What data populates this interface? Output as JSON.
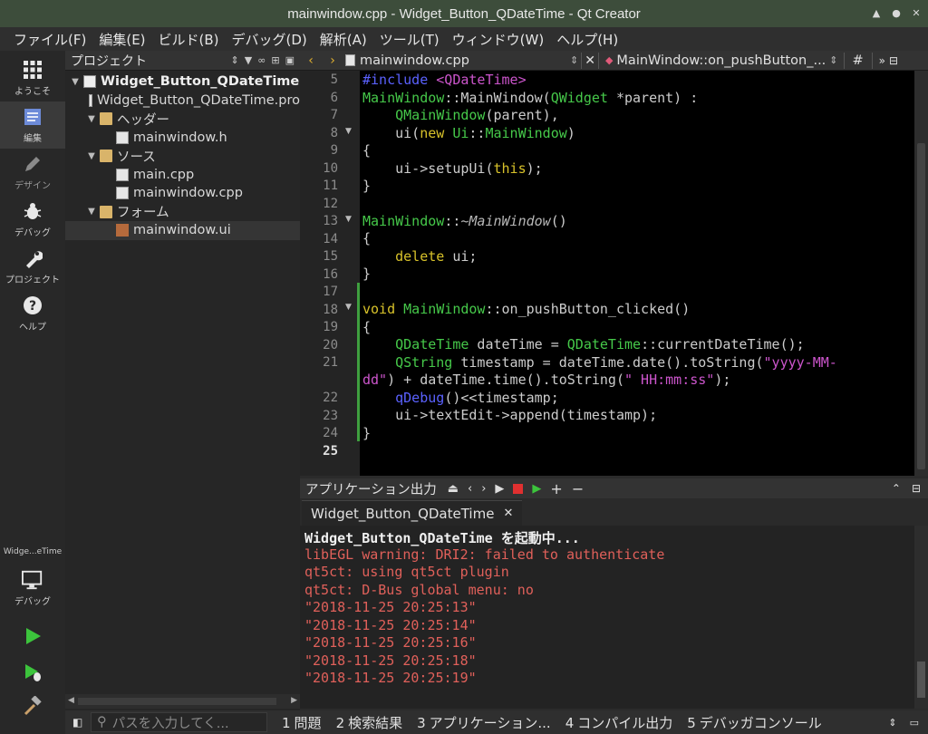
{
  "window": {
    "title": "mainwindow.cpp - Widget_Button_QDateTime - Qt Creator"
  },
  "menu": [
    "ファイル(F)",
    "編集(E)",
    "ビルド(B)",
    "デバッグ(D)",
    "解析(A)",
    "ツール(T)",
    "ウィンドウ(W)",
    "ヘルプ(H)"
  ],
  "modes": [
    {
      "label": "ようこそ",
      "icon": "grid-icon"
    },
    {
      "label": "編集",
      "icon": "edit-icon"
    },
    {
      "label": "デザイン",
      "icon": "pencil-icon"
    },
    {
      "label": "デバッグ",
      "icon": "bug-icon"
    },
    {
      "label": "プロジェクト",
      "icon": "wrench-icon"
    },
    {
      "label": "ヘルプ",
      "icon": "help-icon"
    }
  ],
  "kit": {
    "project": "Widge...eTime",
    "mode": "デバッグ"
  },
  "project_panel": {
    "title": "プロジェクト",
    "tree": [
      {
        "label": "Widget_Button_QDateTime",
        "depth": 0,
        "arrow": "▼",
        "icon": "proj",
        "bold": true
      },
      {
        "label": "Widget_Button_QDateTime.pro",
        "depth": 1,
        "arrow": "",
        "icon": "file"
      },
      {
        "label": "ヘッダー",
        "depth": 1,
        "arrow": "▼",
        "icon": "folder"
      },
      {
        "label": "mainwindow.h",
        "depth": 2,
        "arrow": "",
        "icon": "file"
      },
      {
        "label": "ソース",
        "depth": 1,
        "arrow": "▼",
        "icon": "folder"
      },
      {
        "label": "main.cpp",
        "depth": 2,
        "arrow": "",
        "icon": "file"
      },
      {
        "label": "mainwindow.cpp",
        "depth": 2,
        "arrow": "",
        "icon": "file"
      },
      {
        "label": "フォーム",
        "depth": 1,
        "arrow": "▼",
        "icon": "folder"
      },
      {
        "label": "mainwindow.ui",
        "depth": 2,
        "arrow": "",
        "icon": "ui",
        "selected": true
      }
    ]
  },
  "editor": {
    "file": "mainwindow.cpp",
    "symbol": "MainWindow::on_pushButton_...",
    "symbol_hash": "#",
    "line_numbers": [
      "5",
      "6",
      "7",
      "8",
      "9",
      "10",
      "11",
      "12",
      "13",
      "14",
      "15",
      "16",
      "17",
      "18",
      "19",
      "20",
      "21",
      "",
      "22",
      "23",
      "24",
      "25"
    ],
    "current_line": "25"
  },
  "output": {
    "header": "アプリケーション出力",
    "tab": "Widget_Button_QDateTime",
    "lines": [
      {
        "text": "Widget_Button_QDateTime を起動中...",
        "style": "b"
      },
      {
        "text": "libEGL warning: DRI2: failed to authenticate",
        "style": "r"
      },
      {
        "text": "qt5ct: using qt5ct plugin",
        "style": "r"
      },
      {
        "text": "qt5ct: D-Bus global menu: no",
        "style": "r"
      },
      {
        "text": "\"2018-11-25 20:25:13\"",
        "style": "r"
      },
      {
        "text": "\"2018-11-25 20:25:14\"",
        "style": "r"
      },
      {
        "text": "\"2018-11-25 20:25:16\"",
        "style": "r"
      },
      {
        "text": "\"2018-11-25 20:25:18\"",
        "style": "r"
      },
      {
        "text": "\"2018-11-25 20:25:19\"",
        "style": "r"
      }
    ]
  },
  "statusbar": {
    "locator_placeholder": "パスを入力してく...",
    "tabs": [
      {
        "n": "1",
        "label": "問題"
      },
      {
        "n": "2",
        "label": "検索結果"
      },
      {
        "n": "3",
        "label": "アプリケーション..."
      },
      {
        "n": "4",
        "label": "コンパイル出力"
      },
      {
        "n": "5",
        "label": "デバッガコンソール"
      }
    ]
  }
}
